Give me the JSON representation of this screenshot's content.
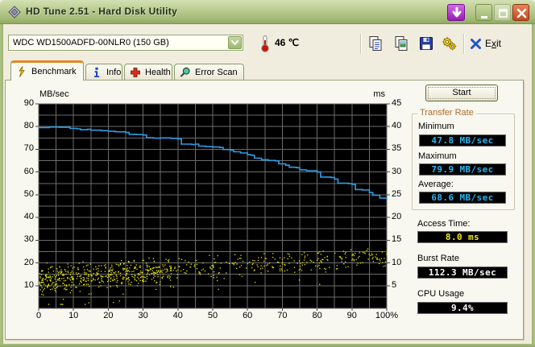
{
  "window": {
    "title": "HD Tune 2.51 - Hard Disk Utility"
  },
  "toolbar": {
    "drive_combo": {
      "value": "WDC WD1500ADFD-00NLR0 (150 GB)"
    },
    "temperature": "46 ℃",
    "exit": {
      "label": "Exit",
      "accel": "x"
    }
  },
  "tabs": [
    {
      "id": "benchmark",
      "label": "Benchmark",
      "icon": "lightning-icon",
      "active": true
    },
    {
      "id": "info",
      "label": "Info",
      "icon": "info-icon",
      "active": false
    },
    {
      "id": "health",
      "label": "Health",
      "icon": "health-cross-icon",
      "active": false
    },
    {
      "id": "error-scan",
      "label": "Error Scan",
      "icon": "magnifier-icon",
      "active": false
    }
  ],
  "benchmark_panel": {
    "start_button": "Start",
    "transfer_rate": {
      "group_label": "Transfer Rate",
      "minimum_label": "Minimum",
      "minimum_value": "47.8 MB/sec",
      "maximum_label": "Maximum",
      "maximum_value": "79.9 MB/sec",
      "average_label": "Average:",
      "average_value": "68.6 MB/sec"
    },
    "access_time_label": "Access Time:",
    "access_time_value": "8.0 ms",
    "burst_rate_label": "Burst Rate",
    "burst_rate_value": "112.3 MB/sec",
    "cpu_usage_label": "CPU Usage",
    "cpu_usage_value": "9.4%"
  },
  "colors": {
    "transfer_line_blue": "#2E9CE3",
    "access_scatter_yellow": "#E8E800",
    "value_cyan": "#28B4F0",
    "value_yellow": "#F0E818",
    "value_white": "#FFFFFF",
    "grid_gray": "#6C6C6C",
    "plot_background": "#000000",
    "groupbox_label_orange": "#B06B2B",
    "active_tab_stripe": "#E2862A"
  },
  "chart_data": {
    "type": "line+scatter",
    "plot_bg": "#000000",
    "grid": {
      "x_step": 5,
      "y_step": 5,
      "color": "#6C6C6C"
    },
    "left_axis": {
      "label": "MB/sec",
      "min": 0,
      "max": 90,
      "ticks": [
        90,
        80,
        70,
        60,
        50,
        40,
        30,
        20,
        10
      ]
    },
    "right_axis": {
      "label": "ms",
      "min": 0,
      "max": 45,
      "ticks": [
        45,
        40,
        35,
        30,
        25,
        20,
        15,
        10,
        5
      ]
    },
    "x_axis": {
      "min": 0,
      "max": 100,
      "values": [
        0,
        10,
        20,
        30,
        40,
        50,
        60,
        70,
        80,
        90,
        100
      ],
      "labels": [
        "0",
        "10",
        "20",
        "30",
        "40",
        "50",
        "60",
        "70",
        "80",
        "90",
        "100%"
      ]
    },
    "series": [
      {
        "name": "transfer-rate",
        "type": "line",
        "axis": "left",
        "units": "MB/sec",
        "color": "#2E9CE3",
        "points": [
          [
            0,
            79.6
          ],
          [
            3,
            79.8
          ],
          [
            6,
            79.7
          ],
          [
            9,
            79.2
          ],
          [
            11,
            79.0
          ],
          [
            12,
            78.6
          ],
          [
            14,
            78.8
          ],
          [
            15,
            78.4
          ],
          [
            18,
            78.2
          ],
          [
            20,
            77.9
          ],
          [
            22,
            77.7
          ],
          [
            25,
            77.4
          ],
          [
            26,
            76.6
          ],
          [
            28,
            76.5
          ],
          [
            30,
            76.3
          ],
          [
            31,
            75.1
          ],
          [
            33,
            74.9
          ],
          [
            35,
            75.0
          ],
          [
            38,
            74.8
          ],
          [
            40,
            74.6
          ],
          [
            41,
            72.3
          ],
          [
            44,
            72.1
          ],
          [
            45,
            72.3
          ],
          [
            46,
            71.4
          ],
          [
            48,
            71.2
          ],
          [
            50,
            71.0
          ],
          [
            52,
            70.8
          ],
          [
            53,
            69.9
          ],
          [
            55,
            69.6
          ],
          [
            56,
            68.9
          ],
          [
            58,
            68.4
          ],
          [
            60,
            67.6
          ],
          [
            61,
            67.4
          ],
          [
            62,
            66.1
          ],
          [
            64,
            65.4
          ],
          [
            66,
            65.1
          ],
          [
            68,
            64.9
          ],
          [
            69,
            63.6
          ],
          [
            71,
            63.0
          ],
          [
            72,
            62.1
          ],
          [
            74,
            61.9
          ],
          [
            75,
            60.9
          ],
          [
            77,
            60.6
          ],
          [
            80,
            60.0
          ],
          [
            81,
            57.8
          ],
          [
            84,
            57.6
          ],
          [
            85,
            56.9
          ],
          [
            86,
            55.1
          ],
          [
            89,
            54.9
          ],
          [
            90,
            54.6
          ],
          [
            91,
            52.3
          ],
          [
            93,
            52.1
          ],
          [
            95,
            51.0
          ],
          [
            96,
            49.8
          ],
          [
            98,
            48.5
          ],
          [
            100,
            48.0
          ]
        ]
      },
      {
        "name": "access-time",
        "type": "scatter",
        "axis": "right",
        "units": "ms",
        "color": "#E8E800",
        "ms_range_at_0pct": [
          2.6,
          10.2
        ],
        "ms_range_at_100pct": [
          9.1,
          14.2
        ],
        "generator": {
          "seed": 20070613,
          "count": 760,
          "left_bias": 0.42,
          "lower_intercept": 2.6,
          "lower_slope": 0.065,
          "upper_intercept": 10.2,
          "upper_slope": 0.04,
          "low_outlier_rate": 0.03
        }
      }
    ]
  }
}
